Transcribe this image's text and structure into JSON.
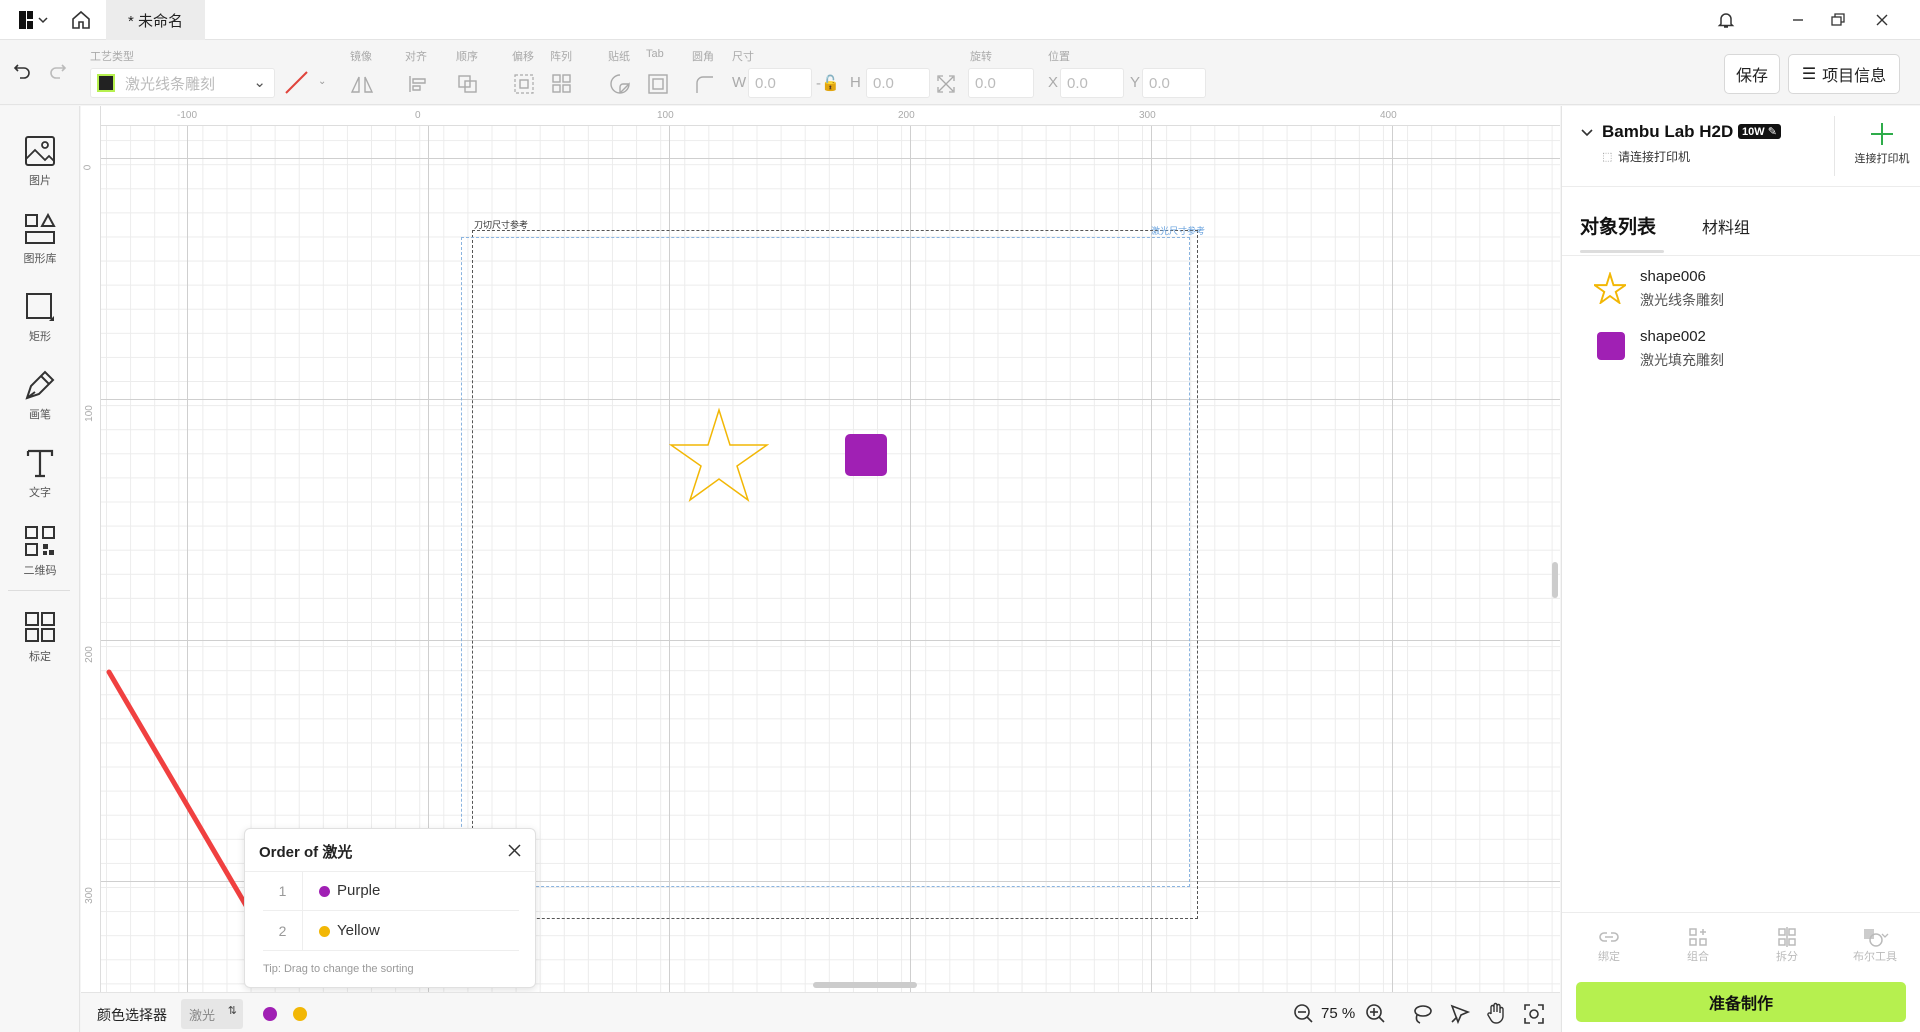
{
  "titlebar": {
    "doc_tab": "* 未命名"
  },
  "toolbar": {
    "process_type_label": "工艺类型",
    "process_type_value": "激光线条雕刻",
    "mirror": "镜像",
    "align": "对齐",
    "order": "顺序",
    "offset": "偏移",
    "array": "阵列",
    "sticker": "贴纸",
    "tab": "Tab",
    "corner": "圆角",
    "size": "尺寸",
    "rotate": "旋转",
    "position": "位置",
    "w_prefix": "W",
    "w_value": "0.0",
    "h_prefix": "H",
    "h_value": "0.0",
    "rotate_value": "0.0",
    "x_prefix": "X",
    "x_value": "0.0",
    "y_prefix": "Y",
    "y_value": "0.0",
    "save_label": "保存",
    "project_info_label": "项目信息"
  },
  "leftbar": {
    "items": [
      "图片",
      "图形库",
      "矩形",
      "画笔",
      "文字",
      "二维码",
      "标定"
    ]
  },
  "canvas": {
    "ruler_h": [
      "-100",
      "0",
      "100",
      "200",
      "300",
      "400"
    ],
    "ruler_v": [
      "0",
      "100",
      "200",
      "300"
    ],
    "blade_ref_label": "刀切尺寸参考",
    "laser_ref_label": "激光尺寸参考",
    "star_color": "#f2b705",
    "square_color": "#a020b4"
  },
  "printer": {
    "name": "Bambu Lab H2D",
    "badge": "10W",
    "status": "请连接打印机",
    "connect_label": "连接打印机"
  },
  "rightpanel": {
    "tabs": [
      "对象列表",
      "材料组"
    ],
    "objects": [
      {
        "name": "shape006",
        "process": "激光线条雕刻"
      },
      {
        "name": "shape002",
        "process": "激光填充雕刻"
      }
    ],
    "bottom_tools": [
      "绑定",
      "组合",
      "拆分",
      "布尔工具"
    ],
    "prepare_label": "准备制作",
    "accent": "#b6f04f"
  },
  "order_popup": {
    "title": "Order of 激光",
    "rows": [
      {
        "num": "1",
        "label": "Purple",
        "color": "#a020b4"
      },
      {
        "num": "2",
        "label": "Yellow",
        "color": "#f2b705"
      }
    ],
    "tip": "Tip: Drag to change the sorting"
  },
  "bottombar": {
    "color_picker_label": "颜色选择器",
    "mode_value": "激光",
    "zoom": "75 %"
  }
}
